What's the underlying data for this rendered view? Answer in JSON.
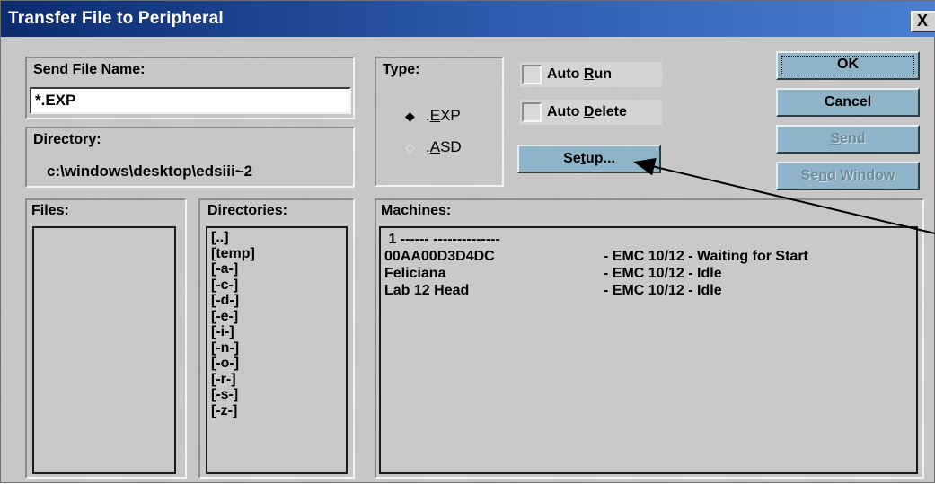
{
  "window": {
    "title": "Transfer File to Peripheral",
    "close_label": "X"
  },
  "send_file": {
    "label": "Send File Name:",
    "value": "*.EXP"
  },
  "directory": {
    "label": "Directory:",
    "path": "c:\\windows\\desktop\\edsiii~2"
  },
  "type": {
    "label": "Type:",
    "options": [
      {
        "pre": ".",
        "hot": "E",
        "post": "XP",
        "selected": true
      },
      {
        "pre": ".",
        "hot": "A",
        "post": "SD",
        "selected": false
      }
    ]
  },
  "auto_run": {
    "pre": "Auto ",
    "hot": "R",
    "post": "un",
    "checked": false
  },
  "auto_delete": {
    "pre": "Auto ",
    "hot": "D",
    "post": "elete",
    "checked": false
  },
  "setup_button": {
    "pre": "Se",
    "hot": "t",
    "post": "up..."
  },
  "buttons": {
    "ok": "OK",
    "cancel": "Cancel",
    "send": {
      "pre": "",
      "hot": "S",
      "post": "end",
      "enabled": false
    },
    "send_window": {
      "pre": "Se",
      "hot": "n",
      "post": "d Window",
      "enabled": false
    }
  },
  "files": {
    "label": "Files:",
    "items": []
  },
  "directories": {
    "label": "Directories:",
    "items": [
      "[..]",
      "[temp]",
      "[-a-]",
      "[-c-]",
      "[-d-]",
      "[-e-]",
      "[-i-]",
      "[-n-]",
      "[-o-]",
      "[-r-]",
      "[-s-]",
      "[-z-]"
    ]
  },
  "machines": {
    "label": "Machines:",
    "rows": [
      {
        "name": " 1 ------ --------------",
        "status": ""
      },
      {
        "name": "00AA00D3D4DC",
        "status": "- EMC 10/12 - Waiting for Start"
      },
      {
        "name": "Feliciana",
        "status": "- EMC 10/12 - Idle"
      },
      {
        "name": "Lab 12 Head",
        "status": "- EMC 10/12 - Idle"
      }
    ]
  },
  "colors": {
    "face": "#c9c9c9",
    "button": "#8fb3c7",
    "title_start": "#0b2b6e",
    "title_end": "#4a7fd2"
  },
  "icons": [
    "radio-selected-icon",
    "radio-unselected-icon",
    "close-icon",
    "callout-arrow"
  ]
}
